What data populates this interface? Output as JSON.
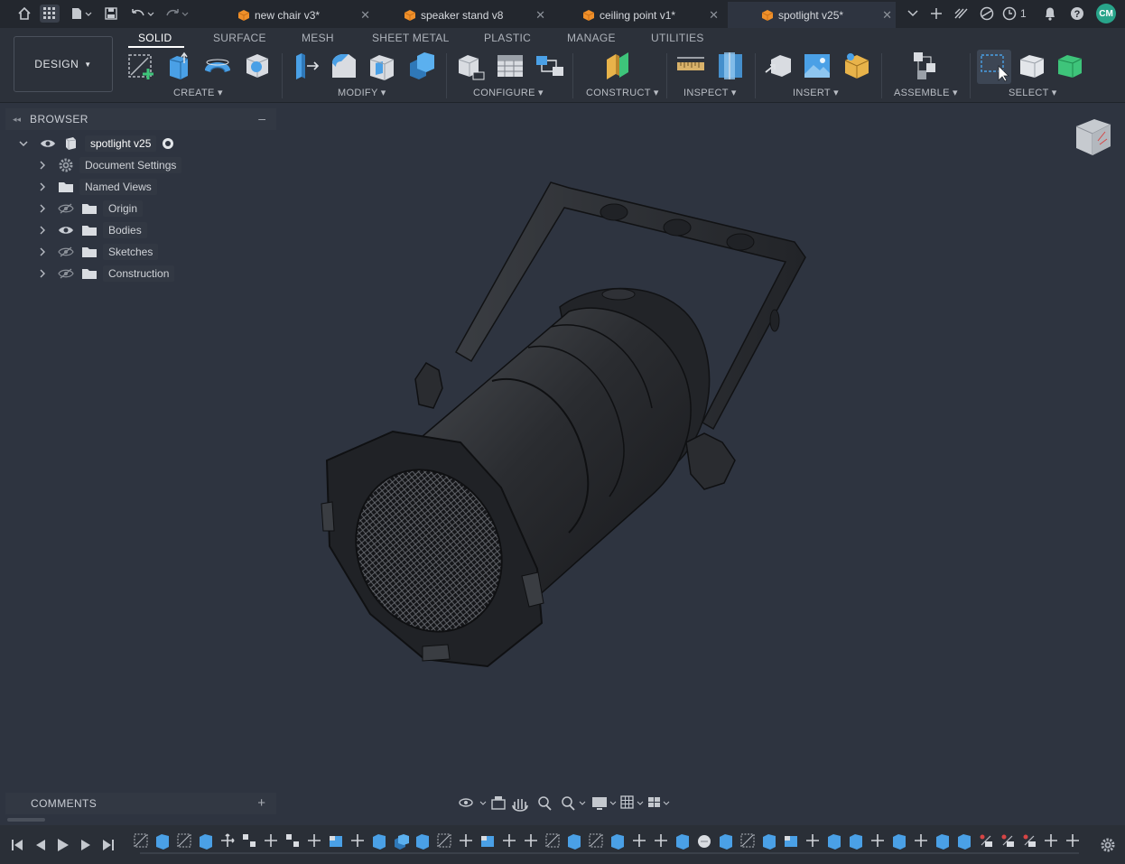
{
  "tabs": [
    {
      "label": "new chair v3*",
      "active": false
    },
    {
      "label": "speaker stand v8",
      "active": false
    },
    {
      "label": "ceiling point v1*",
      "active": false
    },
    {
      "label": "spotlight v25*",
      "active": true
    }
  ],
  "system": {
    "job_count": "1",
    "user_initials": "CM"
  },
  "workspace": {
    "design_label": "DESIGN"
  },
  "ribbon": {
    "tabs": [
      "SOLID",
      "SURFACE",
      "MESH",
      "SHEET METAL",
      "PLASTIC",
      "MANAGE",
      "UTILITIES"
    ],
    "groups": [
      "CREATE",
      "MODIFY",
      "CONFIGURE",
      "CONSTRUCT",
      "INSPECT",
      "INSERT",
      "ASSEMBLE",
      "SELECT"
    ]
  },
  "browser": {
    "title": "BROWSER",
    "root": "spotlight v25",
    "items": [
      "Document Settings",
      "Named Views",
      "Origin",
      "Bodies",
      "Sketches",
      "Construction"
    ]
  },
  "comments": {
    "title": "COMMENTS"
  },
  "colors": {
    "background": "#2e3440",
    "tab_bar": "#23272e",
    "ribbon": "#2c313a",
    "accent_green": "#3ec47a",
    "accent_blue": "#4aa0e6",
    "document_orange": "#f0902a",
    "avatar_teal": "#28a48a"
  }
}
